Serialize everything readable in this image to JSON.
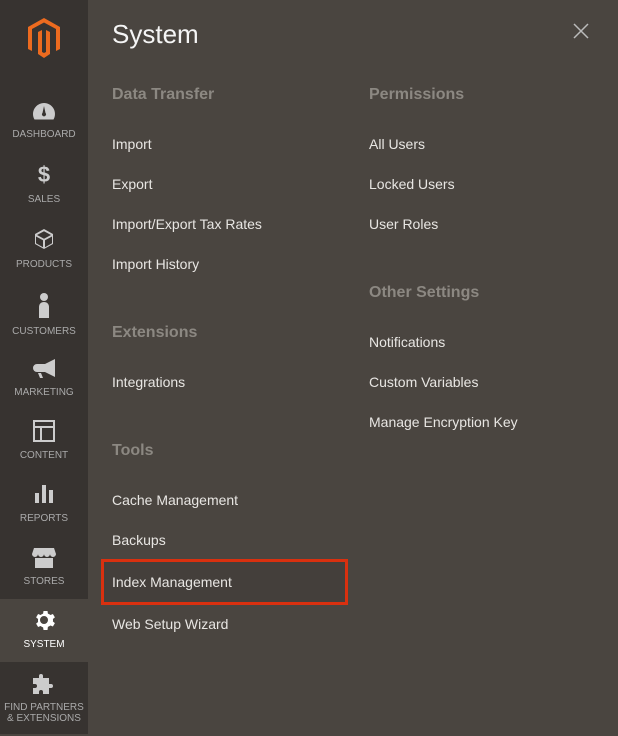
{
  "panelTitle": "System",
  "sidebar": {
    "items": [
      {
        "label": "DASHBOARD"
      },
      {
        "label": "SALES"
      },
      {
        "label": "PRODUCTS"
      },
      {
        "label": "CUSTOMERS"
      },
      {
        "label": "MARKETING"
      },
      {
        "label": "CONTENT"
      },
      {
        "label": "REPORTS"
      },
      {
        "label": "STORES"
      },
      {
        "label": "SYSTEM"
      },
      {
        "label": "FIND PARTNERS & EXTENSIONS"
      }
    ]
  },
  "leftColumn": {
    "sections": [
      {
        "heading": "Data Transfer",
        "links": [
          "Import",
          "Export",
          "Import/Export Tax Rates",
          "Import History"
        ]
      },
      {
        "heading": "Extensions",
        "links": [
          "Integrations"
        ]
      },
      {
        "heading": "Tools",
        "links": [
          "Cache Management",
          "Backups",
          "Index Management",
          "Web Setup Wizard"
        ]
      }
    ]
  },
  "rightColumn": {
    "sections": [
      {
        "heading": "Permissions",
        "links": [
          "All Users",
          "Locked Users",
          "User Roles"
        ]
      },
      {
        "heading": "Other Settings",
        "links": [
          "Notifications",
          "Custom Variables",
          "Manage Encryption Key"
        ]
      }
    ]
  },
  "highlightedLink": "Index Management"
}
